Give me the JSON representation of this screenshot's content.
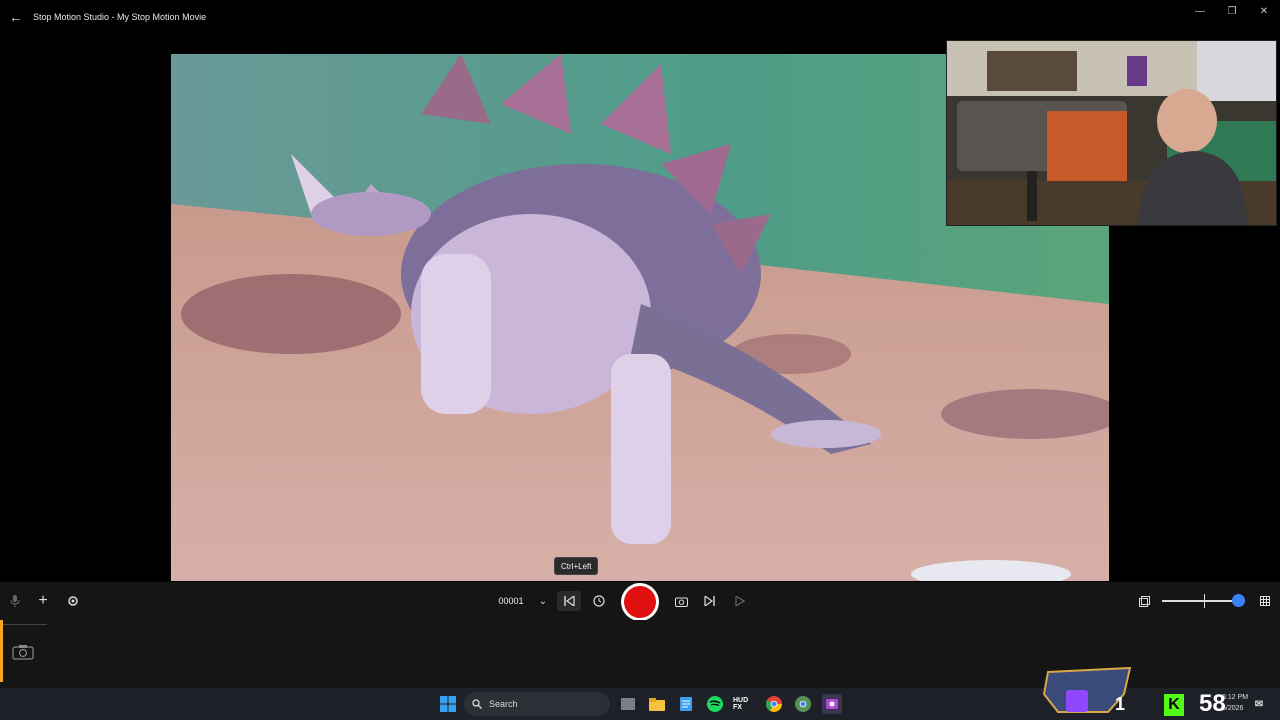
{
  "window": {
    "title": "Stop Motion Studio - My Stop Motion Movie",
    "back_icon": "arrow-left-icon",
    "controls": [
      "minimize-icon",
      "maximize-icon",
      "close-icon"
    ]
  },
  "viewer": {
    "tooltip": "Ctrl+Left"
  },
  "controls": {
    "frame_number": "00001",
    "icons": [
      "microphone-icon",
      "plus-icon",
      "settings-icon",
      "chevron-down-icon",
      "skip-to-start-icon",
      "timer-icon",
      "record-button",
      "camera-capture-icon",
      "skip-to-end-icon",
      "play-icon",
      "overlay-icon",
      "grid-icon"
    ],
    "zoom_level": 0.95
  },
  "timeline": {
    "camera_icon": "camera-icon"
  },
  "taskbar": {
    "search_placeholder": "Search",
    "apps": [
      "windows-start-icon",
      "search-icon",
      "task-view-icon",
      "file-explorer-icon",
      "notepad-icon",
      "spotify-icon",
      "hud-fx-icon",
      "chrome-icon",
      "chrome-alt-icon",
      "stop-motion-icon"
    ],
    "hud_label": "HUD FX",
    "time": "6:12 PM",
    "date": "5/2026"
  },
  "stream_overlay": {
    "twitch_count": "1",
    "kick_count": "58"
  },
  "colors": {
    "record": "#e01010",
    "zoom_accent": "#3b82f6",
    "timeline_marker": "#f5a623",
    "kick": "#53fc18",
    "twitch": "#9146ff"
  }
}
